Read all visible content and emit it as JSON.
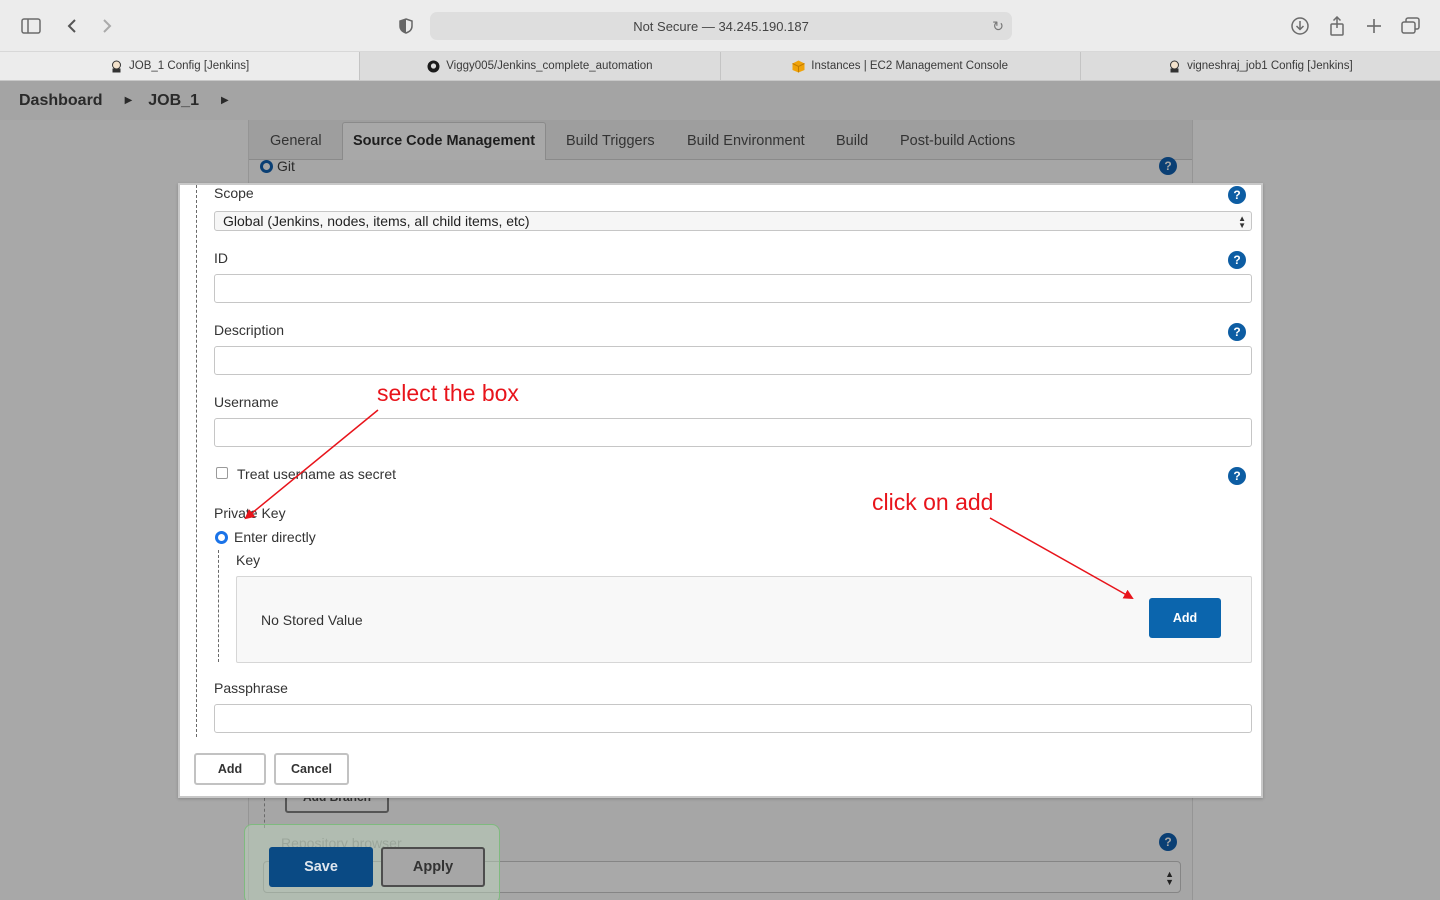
{
  "browser": {
    "address": "Not Secure — 34.245.190.187",
    "tabs": [
      {
        "label": "JOB_1 Config [Jenkins]",
        "icon": "jenkins-icon"
      },
      {
        "label": "Viggy005/Jenkins_complete_automation",
        "icon": "github-icon"
      },
      {
        "label": "Instances | EC2 Management Console",
        "icon": "aws-icon"
      },
      {
        "label": "vigneshraj_job1 Config [Jenkins]",
        "icon": "jenkins-icon"
      }
    ]
  },
  "breadcrumb": {
    "dashboard": "Dashboard",
    "job": "JOB_1"
  },
  "config_tabs": [
    "General",
    "Source Code Management",
    "Build Triggers",
    "Build Environment",
    "Build",
    "Post-build Actions"
  ],
  "scm": {
    "git_label": "Git"
  },
  "modal": {
    "scope_label": "Scope",
    "scope_value": "Global (Jenkins, nodes, items, all child items, etc)",
    "id_label": "ID",
    "description_label": "Description",
    "username_label": "Username",
    "treat_secret_label": "Treat username as secret",
    "private_key_label": "Private Key",
    "enter_directly_label": "Enter directly",
    "key_label": "Key",
    "no_stored_value": "No Stored Value",
    "key_add_button": "Add",
    "passphrase_label": "Passphrase",
    "add_button": "Add",
    "cancel_button": "Cancel"
  },
  "background": {
    "add_branch_button": "Add Branch",
    "repository_browser_label": "Repository browser",
    "save_button": "Save",
    "apply_button": "Apply"
  },
  "annotations": {
    "select_box": "select the box",
    "click_add": "click on add",
    "color": "#e8141b"
  }
}
